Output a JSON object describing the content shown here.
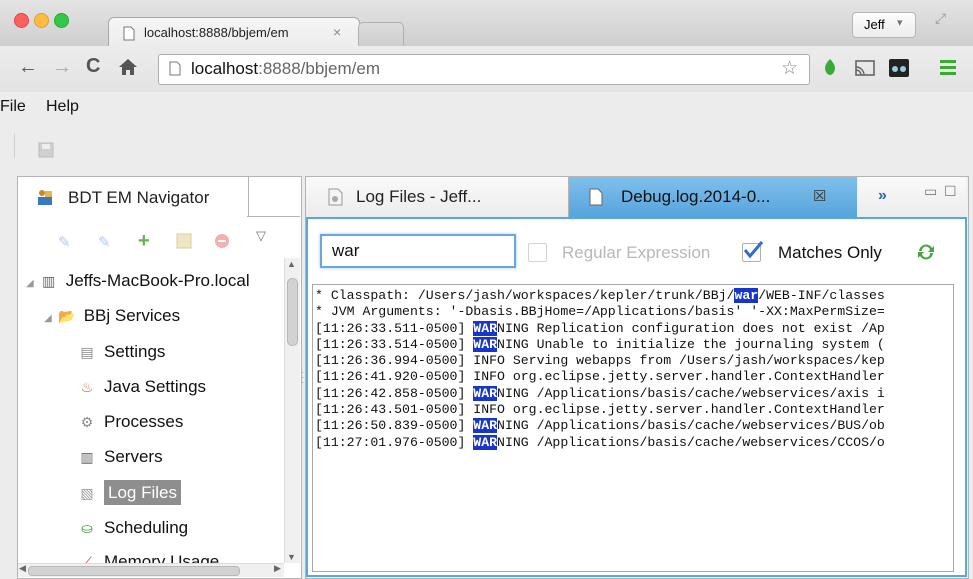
{
  "browser": {
    "tab_title": "localhost:8888/bbjem/em",
    "profile_name": "Jeff",
    "url_host": "localhost",
    "url_rest": ":8888/bbjem/em"
  },
  "menu": {
    "file": "File",
    "help": "Help"
  },
  "navigator": {
    "title": "BDT EM Navigator",
    "host": "Jeffs-MacBook-Pro.local",
    "group": "BBj Services",
    "items": [
      "Settings",
      "Java Settings",
      "Processes",
      "Servers",
      "Log Files",
      "Scheduling",
      "Memory Usage"
    ]
  },
  "editor": {
    "tab1_label": "Log Files - Jeff...",
    "tab2_label": "Debug.log.2014-0...",
    "search_value": "war",
    "regex_label": "Regular Expression",
    "matches_only_label": "Matches Only",
    "log_lines": [
      {
        "pre": "* Classpath: /Users/jash/workspaces/kepler/trunk/BBj/",
        "hl": "war",
        "post": "/WEB-INF/classes"
      },
      {
        "pre": "* JVM Arguments: '-Dbasis.BBjHome=/Applications/basis' '-XX:MaxPermSize=",
        "hl": "",
        "post": ""
      },
      {
        "pre": "[11:26:33.511-0500] ",
        "hl": "WAR",
        "post": "NING Replication configuration does not exist /Ap"
      },
      {
        "pre": "[11:26:33.514-0500] ",
        "hl": "WAR",
        "post": "NING Unable to initialize the journaling system ("
      },
      {
        "pre": "[11:26:36.994-0500] INFO Serving webapps from /Users/jash/workspaces/kep",
        "hl": "",
        "post": ""
      },
      {
        "pre": "[11:26:41.920-0500] INFO org.eclipse.jetty.server.handler.ContextHandler",
        "hl": "",
        "post": ""
      },
      {
        "pre": "[11:26:42.858-0500] ",
        "hl": "WAR",
        "post": "NING /Applications/basis/cache/webservices/axis i"
      },
      {
        "pre": "[11:26:43.501-0500] INFO org.eclipse.jetty.server.handler.ContextHandler",
        "hl": "",
        "post": ""
      },
      {
        "pre": "[11:26:50.839-0500] ",
        "hl": "WAR",
        "post": "NING /Applications/basis/cache/webservices/BUS/ob"
      },
      {
        "pre": "[11:27:01.976-0500] ",
        "hl": "WAR",
        "post": "NING /Applications/basis/cache/webservices/CCOS/o"
      }
    ]
  },
  "colors": {
    "accent_tab": "#56a4dc",
    "highlight": "#1836c9",
    "chrome_menu_green": "#3aaa35"
  }
}
